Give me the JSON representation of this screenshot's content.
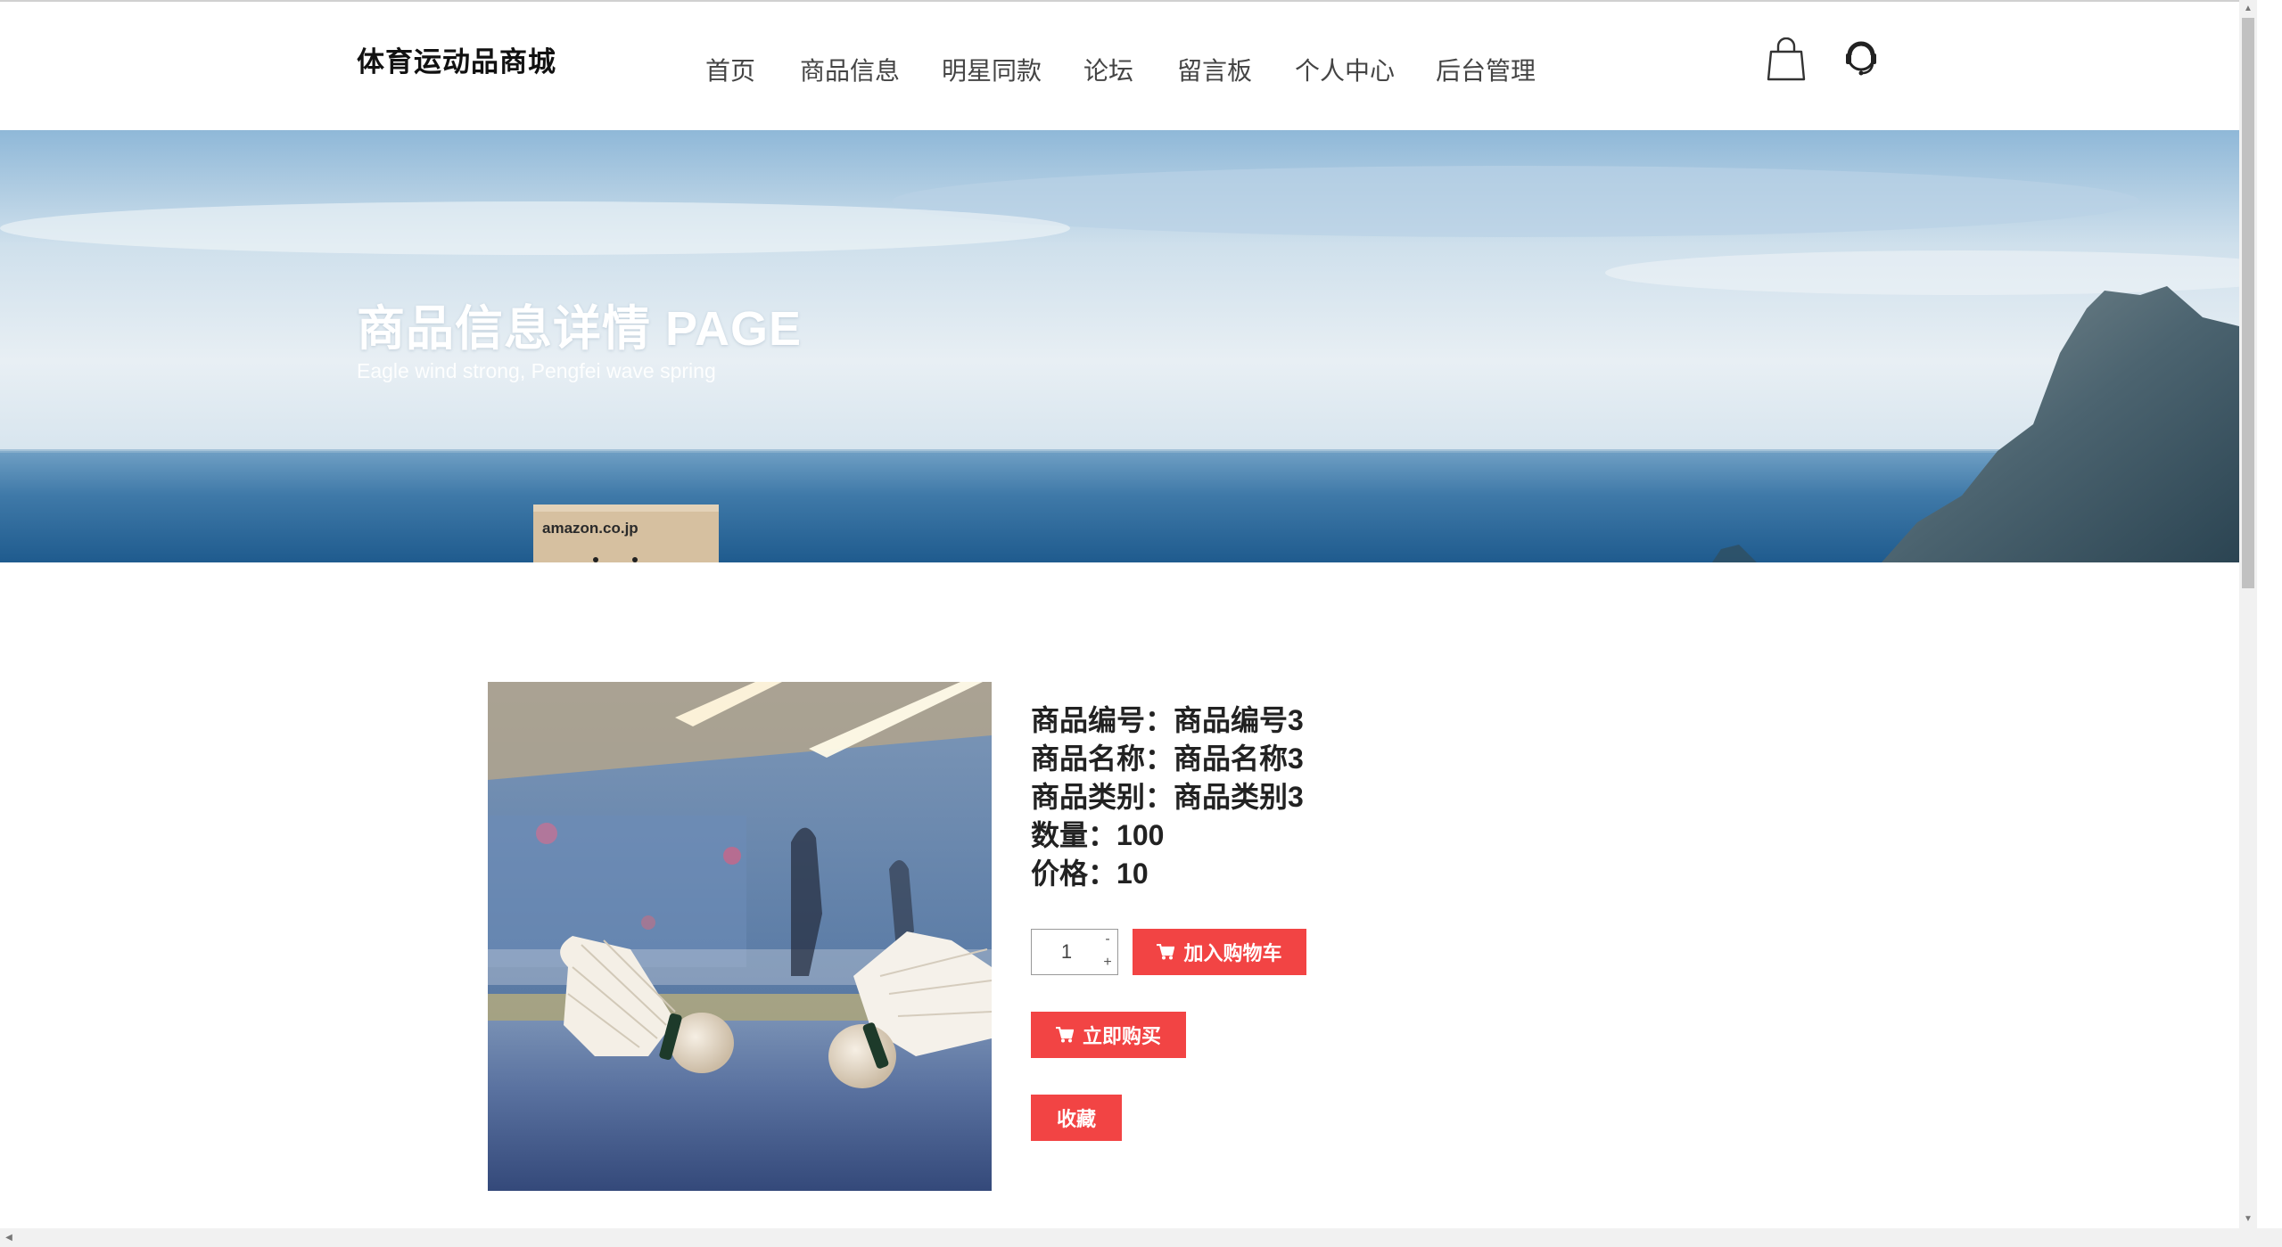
{
  "header": {
    "logo": "体育运动品商城",
    "nav": [
      {
        "label": "首页"
      },
      {
        "label": "商品信息"
      },
      {
        "label": "明星同款"
      },
      {
        "label": "论坛"
      },
      {
        "label": "留言板"
      },
      {
        "label": "个人中心"
      },
      {
        "label": "后台管理"
      }
    ],
    "icons": [
      "shopping-bag-icon",
      "customer-service-icon"
    ]
  },
  "banner": {
    "title": "商品信息详情 PAGE",
    "subtitle": "Eagle wind strong, Pengfei wave spring",
    "box_text": "amazon.co.jp"
  },
  "product": {
    "image": "badminton-shuttlecocks-photo",
    "fields": [
      {
        "label": "商品编号：",
        "value": "商品编号3"
      },
      {
        "label": "商品名称：",
        "value": "商品名称3"
      },
      {
        "label": "商品类别：",
        "value": "商品类别3"
      },
      {
        "label": "数量：",
        "value": "100"
      },
      {
        "label": "价格：",
        "value": "10"
      }
    ],
    "quantity": "1",
    "qty_minus": "-",
    "qty_plus": "+",
    "add_to_cart_label": "加入购物车",
    "buy_now_label": "立即购买",
    "favorite_label": "收藏"
  },
  "colors": {
    "accent_red": "#f24444",
    "header_bg": "#ffffff",
    "sky_blue": "#a9cbe4"
  }
}
